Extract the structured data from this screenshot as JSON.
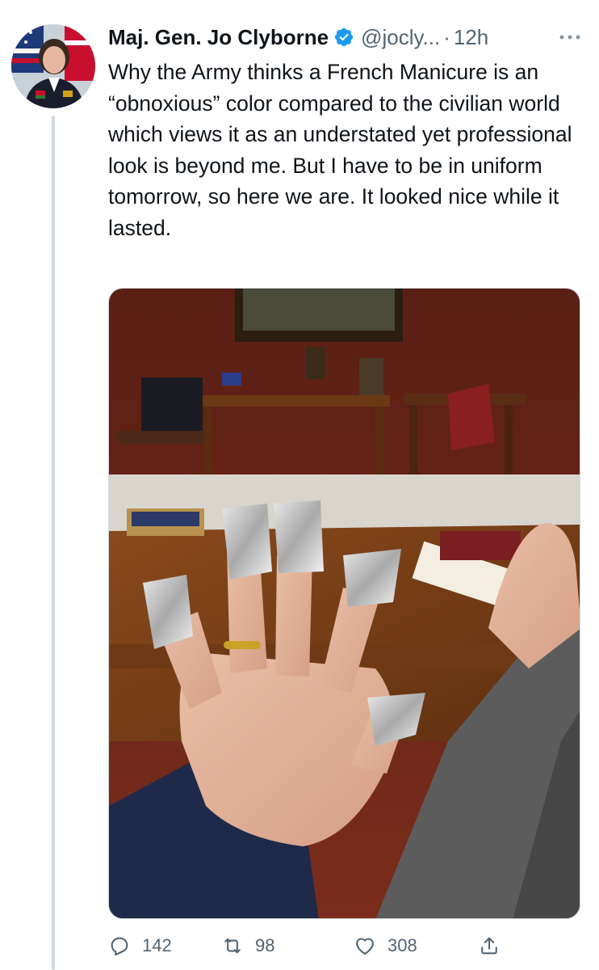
{
  "tweet": {
    "author_name": "Maj. Gen. Jo Clyborne",
    "handle": "@jocly...",
    "separator": "·",
    "time": "12h",
    "text": "Why the Army thinks a French Manicure is an “obnoxious” color compared to the civilian world which views it as an understated yet professional look is beyond me. But I have to be in uniform tomorrow, so here we are. It looked nice while it lasted."
  },
  "actions": {
    "replies": "142",
    "retweets": "98",
    "likes": "308"
  },
  "icons": {
    "verified": "verified-badge-icon",
    "more": "more-dots-icon",
    "reply": "reply-icon",
    "retweet": "retweet-icon",
    "like": "heart-icon",
    "share": "share-icon"
  },
  "colors": {
    "verified_blue": "#1d9bf0",
    "secondary_text": "#536471",
    "primary_text": "#0f1419"
  }
}
